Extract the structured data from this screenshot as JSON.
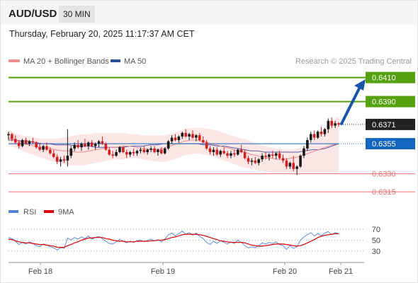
{
  "header": {
    "pair": "AUD/USD",
    "timeframe": "30 MIN",
    "timestamp": "Thursday, February 20, 2025 11:17:37 AM CET"
  },
  "legend": {
    "ma20_bb": "MA 20 + Bollinger Bands",
    "ma50": "MA 50",
    "credit": "Research © 2025 Trading Central",
    "rsi": "RSI",
    "ma9": "9MA"
  },
  "colors": {
    "up": "#1a1a1a",
    "down": "#d21f1f",
    "bollinger_fill": "#fde3e3",
    "ma20": "#e89090",
    "ma50": "#5b5ea8",
    "resistance": "#55a10f",
    "support": "#ea6f70",
    "pivot": "#1565c0",
    "current": "#222222",
    "arrow": "#1a55a8",
    "rsi": "#5580d8",
    "rsi_ma": "#d90000"
  },
  "chart_data": [
    {
      "type": "candlestick",
      "price_range": [
        0.6308,
        0.6418
      ],
      "x_labels": [
        "Feb 18",
        "Feb 19",
        "Feb 20",
        "Feb 21"
      ],
      "levels": [
        {
          "value": 0.641,
          "label": "0.6410",
          "kind": "resistance"
        },
        {
          "value": 0.639,
          "label": "0.6390",
          "kind": "resistance"
        },
        {
          "value": 0.6371,
          "label": "0.6371",
          "kind": "current"
        },
        {
          "value": 0.6355,
          "label": "0.6355",
          "kind": "pivot"
        },
        {
          "value": 0.633,
          "label": "0.6330",
          "kind": "support"
        },
        {
          "value": 0.6315,
          "label": "0.6315",
          "kind": "support"
        }
      ],
      "projection": {
        "from": 0.6371,
        "to": 0.6408
      },
      "candles": [
        [
          0.6362,
          0.6365,
          0.6358,
          0.6363
        ],
        [
          0.6363,
          0.6364,
          0.6357,
          0.6359
        ],
        [
          0.6359,
          0.6362,
          0.6355,
          0.6356
        ],
        [
          0.6356,
          0.6358,
          0.6351,
          0.6353
        ],
        [
          0.6353,
          0.6359,
          0.6352,
          0.6358
        ],
        [
          0.6358,
          0.636,
          0.6354,
          0.6355
        ],
        [
          0.6355,
          0.6358,
          0.6353,
          0.6357
        ],
        [
          0.6357,
          0.636,
          0.6355,
          0.6356
        ],
        [
          0.6356,
          0.6357,
          0.6351,
          0.6352
        ],
        [
          0.6352,
          0.6355,
          0.6349,
          0.635
        ],
        [
          0.635,
          0.6354,
          0.6348,
          0.6353
        ],
        [
          0.6353,
          0.6356,
          0.6349,
          0.635
        ],
        [
          0.635,
          0.6352,
          0.6346,
          0.6347
        ],
        [
          0.6347,
          0.635,
          0.6343,
          0.6344
        ],
        [
          0.6344,
          0.6346,
          0.6338,
          0.634
        ],
        [
          0.634,
          0.6344,
          0.6336,
          0.6342
        ],
        [
          0.6342,
          0.6345,
          0.6339,
          0.6341
        ],
        [
          0.6341,
          0.6367,
          0.6336,
          0.6345
        ],
        [
          0.6345,
          0.6353,
          0.6343,
          0.6351
        ],
        [
          0.6351,
          0.6356,
          0.6349,
          0.6354
        ],
        [
          0.6354,
          0.6358,
          0.6351,
          0.6352
        ],
        [
          0.6352,
          0.6356,
          0.6349,
          0.6355
        ],
        [
          0.6355,
          0.6359,
          0.6352,
          0.6353
        ],
        [
          0.6353,
          0.6357,
          0.635,
          0.6356
        ],
        [
          0.6356,
          0.6358,
          0.6352,
          0.6353
        ],
        [
          0.6353,
          0.6356,
          0.635,
          0.6355
        ],
        [
          0.6355,
          0.6358,
          0.6352,
          0.6357
        ],
        [
          0.6357,
          0.6361,
          0.6354,
          0.6355
        ],
        [
          0.6355,
          0.6356,
          0.6349,
          0.635
        ],
        [
          0.635,
          0.6352,
          0.6345,
          0.6346
        ],
        [
          0.6346,
          0.6349,
          0.6343,
          0.6345
        ],
        [
          0.6345,
          0.635,
          0.6344,
          0.6348
        ],
        [
          0.6348,
          0.6353,
          0.6347,
          0.6352
        ],
        [
          0.6352,
          0.6353,
          0.6347,
          0.6348
        ],
        [
          0.6348,
          0.635,
          0.6343,
          0.6346
        ],
        [
          0.6346,
          0.6349,
          0.6344,
          0.6348
        ],
        [
          0.6348,
          0.6351,
          0.6345,
          0.6347
        ],
        [
          0.6347,
          0.635,
          0.6345,
          0.6349
        ],
        [
          0.6349,
          0.6352,
          0.6347,
          0.635
        ],
        [
          0.635,
          0.6353,
          0.6347,
          0.6348
        ],
        [
          0.6348,
          0.6351,
          0.6346,
          0.635
        ],
        [
          0.635,
          0.6353,
          0.6348,
          0.6351
        ],
        [
          0.6351,
          0.6353,
          0.6347,
          0.6348
        ],
        [
          0.6348,
          0.6351,
          0.6345,
          0.635
        ],
        [
          0.635,
          0.6352,
          0.6346,
          0.6347
        ],
        [
          0.6347,
          0.6352,
          0.6346,
          0.6351
        ],
        [
          0.6351,
          0.6358,
          0.635,
          0.6357
        ],
        [
          0.6357,
          0.6362,
          0.6355,
          0.636
        ],
        [
          0.636,
          0.6363,
          0.6357,
          0.6358
        ],
        [
          0.6358,
          0.6362,
          0.6356,
          0.6361
        ],
        [
          0.6361,
          0.6365,
          0.6359,
          0.6364
        ],
        [
          0.6364,
          0.6367,
          0.636,
          0.6361
        ],
        [
          0.6361,
          0.6364,
          0.6358,
          0.6363
        ],
        [
          0.6363,
          0.6366,
          0.6359,
          0.636
        ],
        [
          0.636,
          0.6363,
          0.6357,
          0.6362
        ],
        [
          0.6362,
          0.6364,
          0.6357,
          0.6358
        ],
        [
          0.6358,
          0.6361,
          0.6355,
          0.6356
        ],
        [
          0.6356,
          0.6358,
          0.635,
          0.6351
        ],
        [
          0.6351,
          0.6353,
          0.6346,
          0.6348
        ],
        [
          0.6348,
          0.6352,
          0.6345,
          0.635
        ],
        [
          0.635,
          0.6352,
          0.6345,
          0.6346
        ],
        [
          0.6346,
          0.635,
          0.6344,
          0.6349
        ],
        [
          0.6349,
          0.6352,
          0.6346,
          0.6347
        ],
        [
          0.6347,
          0.6349,
          0.6343,
          0.6345
        ],
        [
          0.6345,
          0.6349,
          0.6343,
          0.6347
        ],
        [
          0.6347,
          0.635,
          0.6344,
          0.6346
        ],
        [
          0.6346,
          0.6351,
          0.6345,
          0.635
        ],
        [
          0.635,
          0.6354,
          0.6347,
          0.6348
        ],
        [
          0.6348,
          0.635,
          0.6342,
          0.6343
        ],
        [
          0.6343,
          0.6345,
          0.6338,
          0.634
        ],
        [
          0.634,
          0.6343,
          0.6337,
          0.6341
        ],
        [
          0.6341,
          0.6344,
          0.6338,
          0.6339
        ],
        [
          0.6339,
          0.6343,
          0.6337,
          0.6342
        ],
        [
          0.6342,
          0.6347,
          0.634,
          0.6345
        ],
        [
          0.6345,
          0.6348,
          0.6342,
          0.6344
        ],
        [
          0.6344,
          0.6347,
          0.6341,
          0.6346
        ],
        [
          0.6346,
          0.6349,
          0.6343,
          0.6345
        ],
        [
          0.6345,
          0.6348,
          0.6342,
          0.6347
        ],
        [
          0.6347,
          0.6349,
          0.6342,
          0.6343
        ],
        [
          0.6343,
          0.6346,
          0.6339,
          0.6341
        ],
        [
          0.6341,
          0.6343,
          0.6334,
          0.6336
        ],
        [
          0.6336,
          0.634,
          0.6334,
          0.6339
        ],
        [
          0.6339,
          0.6345,
          0.6332,
          0.6334
        ],
        [
          0.6334,
          0.6337,
          0.6329,
          0.6336
        ],
        [
          0.6336,
          0.6346,
          0.6335,
          0.6345
        ],
        [
          0.6345,
          0.6353,
          0.6343,
          0.6351
        ],
        [
          0.6351,
          0.636,
          0.6349,
          0.6358
        ],
        [
          0.6358,
          0.6365,
          0.6356,
          0.6363
        ],
        [
          0.6363,
          0.6366,
          0.6358,
          0.636
        ],
        [
          0.636,
          0.6366,
          0.6359,
          0.6365
        ],
        [
          0.6365,
          0.6369,
          0.6361,
          0.6363
        ],
        [
          0.6363,
          0.6368,
          0.6361,
          0.6367
        ],
        [
          0.6367,
          0.6376,
          0.6364,
          0.6374
        ],
        [
          0.6374,
          0.6377,
          0.6368,
          0.637
        ],
        [
          0.637,
          0.6374,
          0.6368,
          0.6372
        ],
        [
          0.6372,
          0.6373,
          0.6369,
          0.6371
        ]
      ],
      "ma20": [
        0.636,
        0.6358,
        0.6356,
        0.6354,
        0.6353,
        0.6352,
        0.6351,
        0.635,
        0.6349,
        0.6349,
        0.6348,
        0.6348,
        0.6349,
        0.635,
        0.6351,
        0.6352,
        0.6352,
        0.6353,
        0.6353,
        0.6352,
        0.6351,
        0.635,
        0.635,
        0.6351,
        0.6353,
        0.6355,
        0.6357,
        0.6358,
        0.6358,
        0.6357,
        0.6355,
        0.6354,
        0.6352,
        0.6351,
        0.6349,
        0.6348,
        0.6346,
        0.6345,
        0.6343,
        0.6343,
        0.6342,
        0.6342,
        0.6343,
        0.6344,
        0.6346,
        0.6348,
        0.635,
        0.6352,
        0.6354,
        0.6355
      ],
      "ma50": [
        0.6358,
        0.6358,
        0.6357,
        0.6357,
        0.6356,
        0.6355,
        0.6355,
        0.6354,
        0.6354,
        0.6354,
        0.6353,
        0.6353,
        0.6353,
        0.6352,
        0.6352,
        0.6352,
        0.6352,
        0.6352,
        0.6353,
        0.6353,
        0.6353,
        0.6354,
        0.6354,
        0.6355,
        0.6355,
        0.6355,
        0.6355,
        0.6355,
        0.6355,
        0.6354,
        0.6354,
        0.6353,
        0.6353,
        0.6352,
        0.6351,
        0.635,
        0.6349,
        0.6349,
        0.6348,
        0.6348,
        0.6348,
        0.6348,
        0.6348,
        0.6348,
        0.6349,
        0.635,
        0.635,
        0.6351,
        0.6353,
        0.6355
      ],
      "bb_upper": [
        0.6366,
        0.6364,
        0.6362,
        0.6361,
        0.636,
        0.6359,
        0.6359,
        0.6359,
        0.636,
        0.6361,
        0.6362,
        0.6363,
        0.6363,
        0.6364,
        0.6364,
        0.6364,
        0.6364,
        0.6364,
        0.6363,
        0.6363,
        0.6362,
        0.6362,
        0.6362,
        0.6362,
        0.6363,
        0.6365,
        0.6367,
        0.6368,
        0.6368,
        0.6368,
        0.6367,
        0.6366,
        0.6364,
        0.6362,
        0.636,
        0.6359,
        0.6357,
        0.6355,
        0.6353,
        0.6352,
        0.6351,
        0.635,
        0.635,
        0.6351,
        0.6353,
        0.6357,
        0.6362,
        0.6368,
        0.6374,
        0.6378
      ],
      "bb_lower": [
        0.6354,
        0.6352,
        0.6349,
        0.6347,
        0.6345,
        0.6343,
        0.6341,
        0.634,
        0.6338,
        0.6337,
        0.6337,
        0.6337,
        0.6338,
        0.6339,
        0.634,
        0.6341,
        0.6342,
        0.6342,
        0.6343,
        0.6343,
        0.6342,
        0.6341,
        0.634,
        0.634,
        0.6341,
        0.6343,
        0.6345,
        0.6346,
        0.6347,
        0.6346,
        0.6345,
        0.6343,
        0.6341,
        0.6339,
        0.6337,
        0.6335,
        0.6334,
        0.6333,
        0.6332,
        0.6331,
        0.6331,
        0.6331,
        0.6331,
        0.6331,
        0.6331,
        0.6331,
        0.6331,
        0.6331,
        0.6331,
        0.6331
      ]
    },
    {
      "type": "line",
      "y_ticks": [
        70,
        50,
        30
      ],
      "ylim": [
        18,
        82
      ],
      "series": [
        {
          "name": "RSI",
          "values": [
            55,
            53,
            48,
            42,
            46,
            43,
            47,
            44,
            40,
            38,
            43,
            41,
            38,
            36,
            32,
            36,
            35,
            54,
            50,
            55,
            52,
            56,
            53,
            58,
            52,
            55,
            57,
            53,
            48,
            44,
            43,
            47,
            52,
            48,
            45,
            48,
            46,
            49,
            50,
            47,
            50,
            52,
            49,
            51,
            47,
            52,
            60,
            63,
            58,
            62,
            67,
            61,
            64,
            59,
            63,
            57,
            53,
            46,
            42,
            48,
            44,
            49,
            46,
            43,
            47,
            44,
            50,
            46,
            40,
            36,
            38,
            36,
            40,
            45,
            43,
            46,
            44,
            47,
            42,
            40,
            33,
            40,
            35,
            38,
            50,
            56,
            60,
            64,
            58,
            62,
            58,
            63,
            66,
            60,
            64,
            62
          ]
        },
        {
          "name": "9MA",
          "values": [
            52,
            51,
            49,
            47,
            46,
            45,
            45,
            44,
            43,
            42,
            42,
            41,
            40,
            39,
            37,
            37,
            37,
            40,
            42,
            45,
            47,
            50,
            52,
            54,
            54,
            55,
            55,
            55,
            53,
            52,
            50,
            49,
            48,
            48,
            47,
            47,
            47,
            48,
            48,
            48,
            48,
            49,
            49,
            50,
            50,
            51,
            53,
            55,
            56,
            58,
            60,
            61,
            61,
            61,
            61,
            60,
            59,
            57,
            55,
            53,
            51,
            49,
            48,
            47,
            46,
            46,
            46,
            46,
            45,
            43,
            41,
            40,
            39,
            39,
            40,
            41,
            42,
            43,
            43,
            43,
            42,
            41,
            40,
            39,
            40,
            42,
            45,
            48,
            51,
            55,
            57,
            59,
            60,
            61,
            62,
            62
          ]
        }
      ]
    }
  ]
}
